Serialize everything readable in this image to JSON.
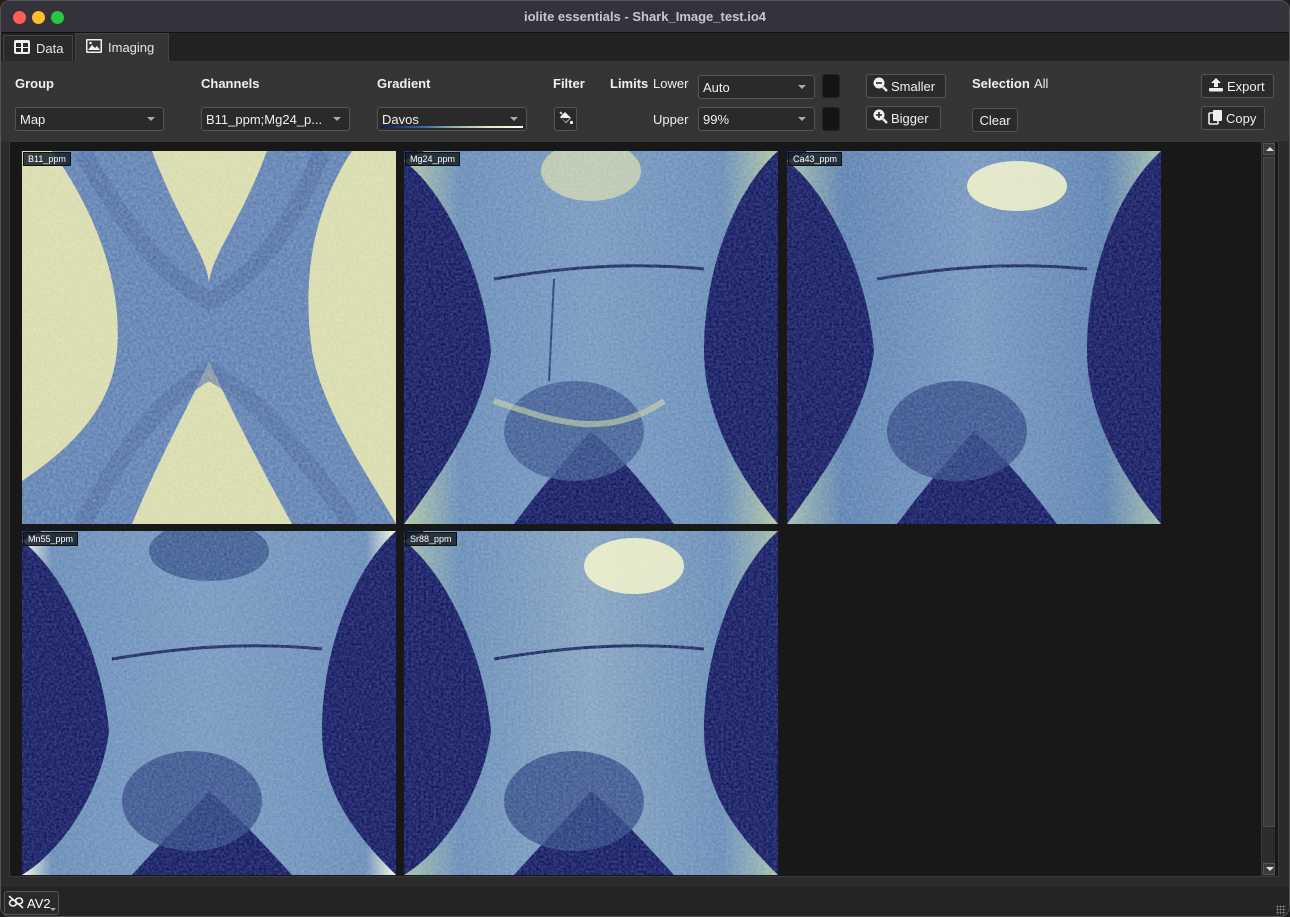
{
  "window": {
    "title": "iolite essentials - Shark_Image_test.io4"
  },
  "tabs": [
    {
      "label": "Data",
      "icon": "table-icon",
      "active": false
    },
    {
      "label": "Imaging",
      "icon": "image-icon",
      "active": true
    }
  ],
  "toolbar": {
    "group": {
      "label": "Group",
      "value": "Map"
    },
    "channels": {
      "label": "Channels",
      "value": "B11_ppm;Mg24_p..."
    },
    "gradient": {
      "label": "Gradient",
      "value": "Davos"
    },
    "filter": {
      "label": "Filter",
      "icon": "paint-bucket-icon"
    },
    "limits": {
      "label": "Limits",
      "lower_label": "Lower",
      "lower_value": "Auto",
      "upper_label": "Upper",
      "upper_value": "99%"
    },
    "smaller_label": "Smaller",
    "bigger_label": "Bigger",
    "selection": {
      "label": "Selection",
      "value": "All",
      "clear_label": "Clear"
    },
    "export_label": "Export",
    "copy_label": "Copy"
  },
  "gradient_colors": [
    "#00085a",
    "#1f3f8a",
    "#4a78b0",
    "#8aa8a8",
    "#d6dca8",
    "#fbfbe8"
  ],
  "maps": [
    {
      "label": "B11_ppm",
      "pattern": "inverse"
    },
    {
      "label": "Mg24_ppm",
      "pattern": "bone"
    },
    {
      "label": "Ca43_ppm",
      "pattern": "bone"
    },
    {
      "label": "Mn55_ppm",
      "pattern": "bone-bright"
    },
    {
      "label": "Sr88_ppm",
      "pattern": "bone"
    }
  ],
  "statusbar": {
    "view_label": "AV2"
  }
}
